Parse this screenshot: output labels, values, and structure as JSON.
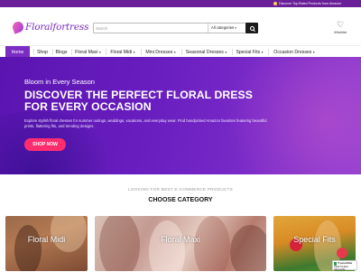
{
  "topbar": {
    "promo_text": "Discover Top-Rated Products from Amazon"
  },
  "header": {
    "logo_text": "Floralfortress",
    "search": {
      "placeholder": "Search",
      "category": "All categories"
    },
    "wishlist_label": "Wishlist"
  },
  "nav": {
    "items": [
      {
        "label": "Home",
        "dropdown": false,
        "active": true
      },
      {
        "label": "Shop",
        "dropdown": false
      },
      {
        "label": "Blogs",
        "dropdown": false
      },
      {
        "label": "Floral Maxi",
        "dropdown": true
      },
      {
        "label": "Floral Midi",
        "dropdown": true
      },
      {
        "label": "Mini Dresses",
        "dropdown": true
      },
      {
        "label": "Seasonal Dresses",
        "dropdown": true
      },
      {
        "label": "Special Fits",
        "dropdown": true
      },
      {
        "label": "Occasion Dresses",
        "dropdown": true
      }
    ]
  },
  "hero": {
    "kicker": "Bloom in Every Season",
    "headline_line1": "DISCOVER THE PERFECT FLORAL DRESS",
    "headline_line2": "FOR EVERY OCCASION",
    "description": "Explore stylish floral dresses for summer outings, weddings, vacations, and everyday wear. Find handpicked Amazon favorites featuring beautiful prints, flattering fits, and trending designs.",
    "cta_label": "SHOP NOW"
  },
  "categories": {
    "subtitle": "LOOKING FOR BEST E-COMMERCE PRODUCTS",
    "title": "CHOOSE CATEGORY",
    "items": [
      {
        "label": "Floral Midi"
      },
      {
        "label": "Floral Maxi"
      },
      {
        "label": "Special Fits"
      }
    ]
  },
  "trust_badge": {
    "title": "TrustedSite",
    "subtitle": "CERTIFIED SECURE"
  },
  "colors": {
    "brand_purple": "#7a2cc3",
    "cta_pink": "#ff2d6f",
    "topbar": "#6a1f99"
  }
}
